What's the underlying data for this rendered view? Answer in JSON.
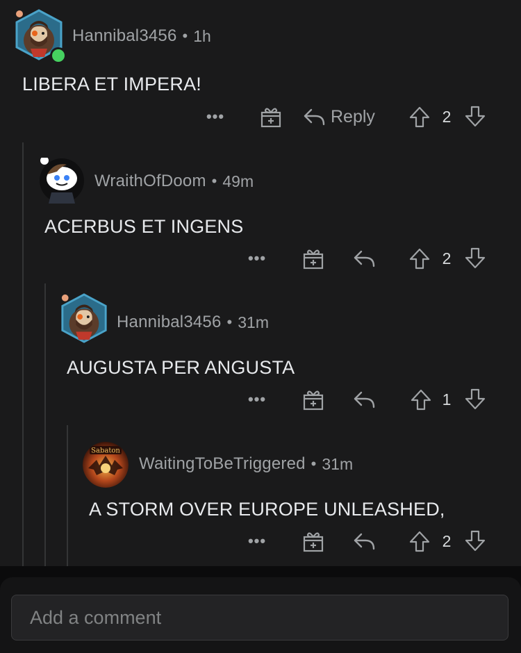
{
  "comments": [
    {
      "username": "Hannibal3456",
      "time": "1h",
      "text": "LIBERA ET IMPERA!",
      "votes": "2",
      "reply_label": "Reply",
      "online": true
    },
    {
      "username": "WraithOfDoom",
      "time": "49m",
      "text": "ACERBUS ET INGENS",
      "votes": "2"
    },
    {
      "username": "Hannibal3456",
      "time": "31m",
      "text": "AUGUSTA PER ANGUSTA",
      "votes": "1"
    },
    {
      "username": "WaitingToBeTriggered",
      "time": "31m",
      "text": "A STORM OVER EUROPE UNLEASHED,",
      "votes": "2",
      "avatar_text": "Sabaton"
    }
  ],
  "separator": "•",
  "more_label": "•••",
  "composer": {
    "placeholder": "Add a comment"
  },
  "colors": {
    "background": "#1a1a1b",
    "text": "#d7dadc",
    "muted": "#a0a3a6",
    "online": "#46d160",
    "thread_line": "#343536"
  },
  "icons": [
    "more-icon",
    "award-icon",
    "reply-icon",
    "upvote-icon",
    "downvote-icon"
  ]
}
